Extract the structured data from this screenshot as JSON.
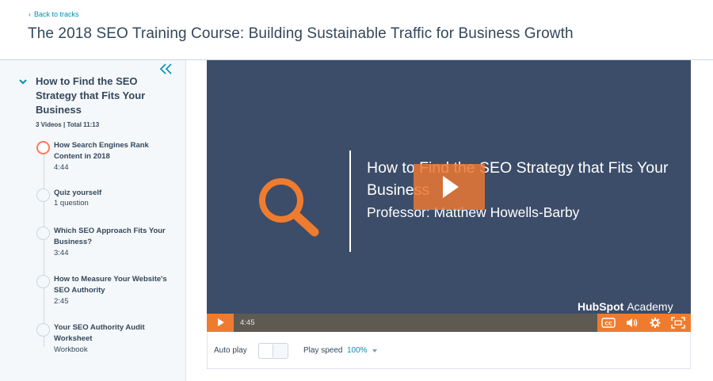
{
  "header": {
    "back_link": "Back to tracks",
    "course_title": "The 2018 SEO Training Course: Building Sustainable Traffic for Business Growth"
  },
  "sidebar": {
    "section_title": "How to Find the SEO Strategy that Fits Your Business",
    "section_meta": "3 Videos | Total 11:13",
    "lessons": [
      {
        "title": "How Search Engines Rank Content in 2018",
        "sub": "4:44",
        "active": true
      },
      {
        "title": "Quiz yourself",
        "sub": "1 question",
        "active": false
      },
      {
        "title": "Which SEO Approach Fits Your Business?",
        "sub": "3:44",
        "active": false
      },
      {
        "title": "How to Measure Your Website's SEO Authority",
        "sub": "2:45",
        "active": false
      },
      {
        "title": "Your SEO Authority Audit Worksheet",
        "sub": "Workbook",
        "active": false
      }
    ]
  },
  "player": {
    "slide_title": "How to Find the SEO Strategy that Fits Your Business",
    "slide_professor": "Professor: Matthew Howells-Barby",
    "watermark_brand": "HubSpot",
    "watermark_suffix": "Academy",
    "time": "4:45",
    "icons": [
      "play-icon",
      "closed-captions-icon",
      "volume-icon",
      "settings-gear-icon",
      "fullscreen-icon",
      "magnifier-icon",
      "double-chevron-left-icon"
    ]
  },
  "settings": {
    "autoplay_label": "Auto play",
    "play_speed_label": "Play speed",
    "play_speed_value": "100%"
  },
  "colors": {
    "accent_orange": "#ef7c2e",
    "slide_bg": "#3c4d69",
    "link_blue": "#0091ae",
    "text_dark": "#33475b"
  }
}
